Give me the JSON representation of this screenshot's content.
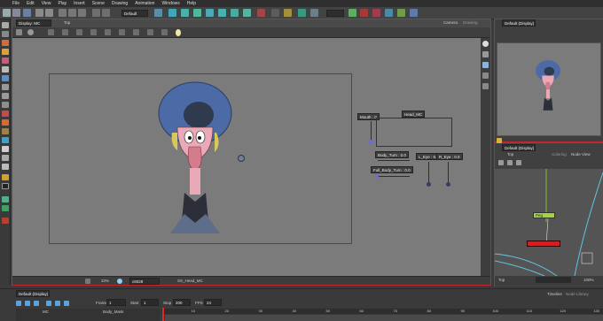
{
  "menu": [
    "File",
    "Edit",
    "View",
    "Play",
    "Insert",
    "Scene",
    "Drawing",
    "Animation",
    "Windows",
    "Help"
  ],
  "toolbar": {
    "workspace": "Default"
  },
  "camera_view": {
    "title": "Display: MC",
    "top_label": "Top",
    "tabs": [
      "Camera",
      "Drawing"
    ],
    "zoom": "33%",
    "status": {
      "frame_label": "c6028",
      "drawing": "SS_Head_MC"
    }
  },
  "controls": {
    "mouth": "Mouth : 0",
    "head": "Head_MC",
    "body_turn": "Body_Turn : 0.0",
    "full_body_turn": "Full_Body_Turn : 0.0",
    "l_eye": "L_Eye : 0.0",
    "r_eye": "R_Eye : 0.0"
  },
  "right_top": {
    "title": "Default (Display)"
  },
  "node_view": {
    "title": "Default (Display)",
    "top_label": "Top",
    "tabs": [
      "Coloring",
      "Node View"
    ],
    "node_label": "Peg",
    "bottom_label": "Top",
    "zoom": "100%"
  },
  "timeline": {
    "title": "Default (Display)",
    "frame_label": "Frame",
    "frame": "1",
    "start_label": "Start",
    "start": "1",
    "stop_label": "Stop",
    "stop": "200",
    "fps_label": "FPS",
    "fps": "24",
    "tabs": [
      "Timeline",
      "Node Library"
    ],
    "layer1": "MC",
    "layer2": "Body_Mask",
    "ruler": [
      "10",
      "20",
      "30",
      "40",
      "50",
      "60",
      "70",
      "80",
      "90",
      "100",
      "110",
      "120",
      "130"
    ]
  },
  "colors": {
    "accent": "#c4262e",
    "canvas": "#7b7b7b",
    "hat": "#4c6aa6",
    "hair": "#d8c85a",
    "skin": "#e9a9b7"
  }
}
